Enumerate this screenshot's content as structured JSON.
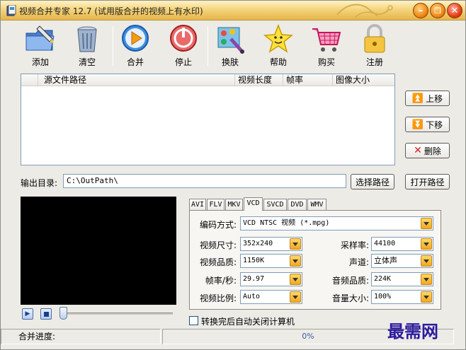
{
  "window": {
    "title": "视频合并专家 12.7 (试用版合并的视频上有水印)",
    "minimize_icon": "minimize-icon",
    "maximize_icon": "restore-icon",
    "close_icon": "close-icon"
  },
  "toolbar": {
    "add_label": "添加",
    "clear_label": "清空",
    "merge_label": "合并",
    "stop_label": "停止",
    "skin_label": "换肤",
    "help_label": "帮助",
    "buy_label": "购买",
    "register_label": "注册"
  },
  "file_list": {
    "columns": [
      "源文件路径",
      "视频长度",
      "帧率",
      "图像大小"
    ],
    "rows": []
  },
  "side_buttons": {
    "up_label": "上移",
    "down_label": "下移",
    "delete_label": "删除"
  },
  "output": {
    "label": "输出目录:",
    "path": "C:\\OutPath\\",
    "choose_label": "选择路径",
    "open_label": "打开路径"
  },
  "format_tabs": [
    "AVI",
    "FLV",
    "MKV",
    "VCD",
    "SVCD",
    "DVD",
    "WMV"
  ],
  "active_tab": "VCD",
  "settings": {
    "encoding_label": "编码方式:",
    "encoding_value": "VCD NTSC 视频 (*.mpg)",
    "size_label": "视频尺寸:",
    "size_value": "352x240",
    "quality_label": "视频品质:",
    "quality_value": "1150K",
    "fps_label": "帧率/秒:",
    "fps_value": "29.97",
    "aspect_label": "视频比例:",
    "aspect_value": "Auto",
    "samplerate_label": "采样率:",
    "samplerate_value": "44100",
    "channel_label": "声道:",
    "channel_value": "立体声",
    "audio_quality_label": "音频品质:",
    "audio_quality_value": "224K",
    "volume_label": "音量大小:",
    "volume_value": "100%"
  },
  "shutdown_checkbox": {
    "label": "转换完后自动关闭计算机",
    "checked": false
  },
  "status": {
    "progress_label": "合并进度:",
    "progress_text": "0%",
    "progress_fraction": 0
  },
  "watermark": "最需网",
  "colors": {
    "title_gradient": "#f2cf72",
    "watermark": "#2b1b9e",
    "combo_arrow": "#f2a81c"
  }
}
